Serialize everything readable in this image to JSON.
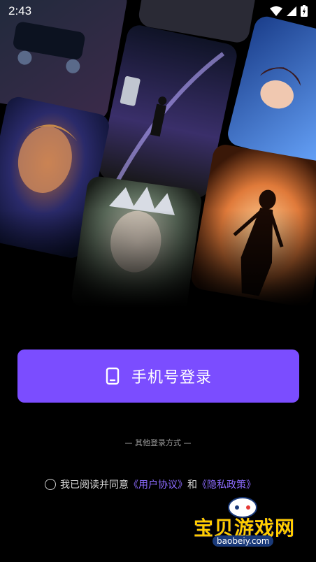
{
  "status": {
    "time": "2:43"
  },
  "login": {
    "label": "手机号登录"
  },
  "other_login": "— 其他登录方式 —",
  "agreement": {
    "prefix": "我已阅读并同意",
    "user_agreement": "《用户协议》",
    "and": "和",
    "privacy_policy": "《隐私政策》"
  },
  "watermark": {
    "title": "宝贝游戏网",
    "url": "baobeiy.com"
  },
  "colors": {
    "accent": "#7b4dff",
    "link": "#8c6bff",
    "background": "#000000"
  }
}
